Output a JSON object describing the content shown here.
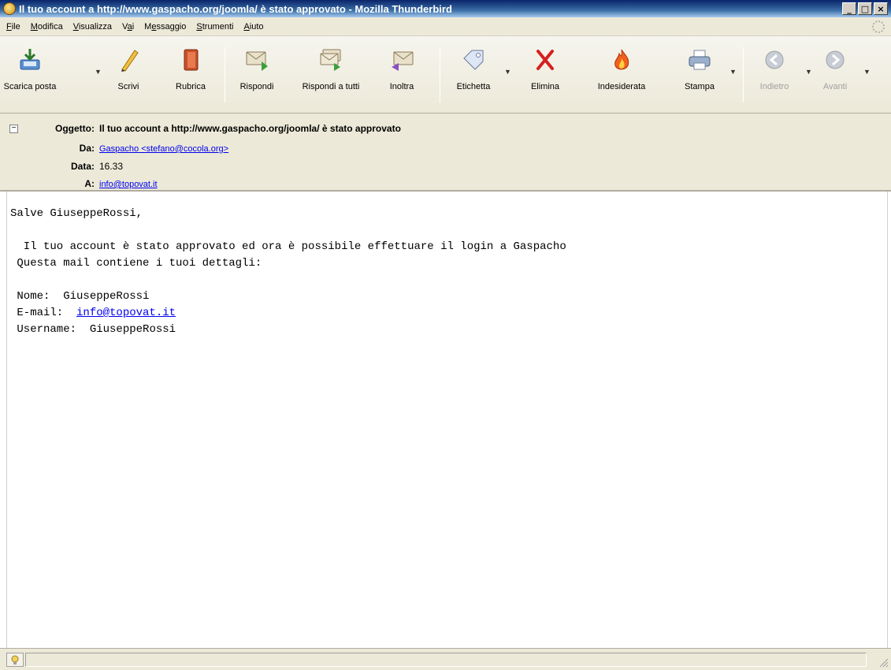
{
  "window": {
    "title": "Il tuo account a http://www.gaspacho.org/joomla/ è stato approvato - Mozilla Thunderbird",
    "minimize": "_",
    "maximize": "□",
    "close": "×"
  },
  "menu": [
    {
      "pre": "",
      "acc": "F",
      "post": "ile"
    },
    {
      "pre": "",
      "acc": "M",
      "post": "odifica"
    },
    {
      "pre": "",
      "acc": "V",
      "post": "isualizza"
    },
    {
      "pre": "V",
      "acc": "a",
      "post": "i"
    },
    {
      "pre": "M",
      "acc": "e",
      "post": "ssaggio"
    },
    {
      "pre": "",
      "acc": "S",
      "post": "trumenti"
    },
    {
      "pre": "",
      "acc": "A",
      "post": "iuto"
    }
  ],
  "toolbar": {
    "get_mail": "Scarica posta",
    "write": "Scrivi",
    "address_book": "Rubrica",
    "reply": "Rispondi",
    "reply_all": "Rispondi a tutti",
    "forward": "Inoltra",
    "tag": "Etichetta",
    "delete": "Elimina",
    "junk": "Indesiderata",
    "print": "Stampa",
    "back": "Indietro",
    "forward_nav": "Avanti"
  },
  "header": {
    "collapse": "−",
    "subject_label": "Oggetto:",
    "subject": "Il tuo account a http://www.gaspacho.org/joomla/ è stato approvato",
    "from_label": "Da:",
    "from": "Gaspacho <stefano@cocola.org>",
    "date_label": "Data:",
    "date": "16.33",
    "to_label": "A:",
    "to": "info@topovat.it"
  },
  "body": {
    "greeting": "Salve GiuseppeRossi,",
    "line1": "  Il tuo account è stato approvato ed ora è possibile effettuare il login a Gaspacho",
    "line2": " Questa mail contiene i tuoi dettagli:",
    "name_label": " Nome:  ",
    "name_value": "GiuseppeRossi",
    "email_label": " E-mail:  ",
    "email_value": "info@topovat.it",
    "username_label": " Username:  ",
    "username_value": "GiuseppeRossi"
  },
  "colors": {
    "titlebar": "#0a246a",
    "chrome": "#ece9d8",
    "link": "#0000ee",
    "delete_red": "#d42020"
  }
}
